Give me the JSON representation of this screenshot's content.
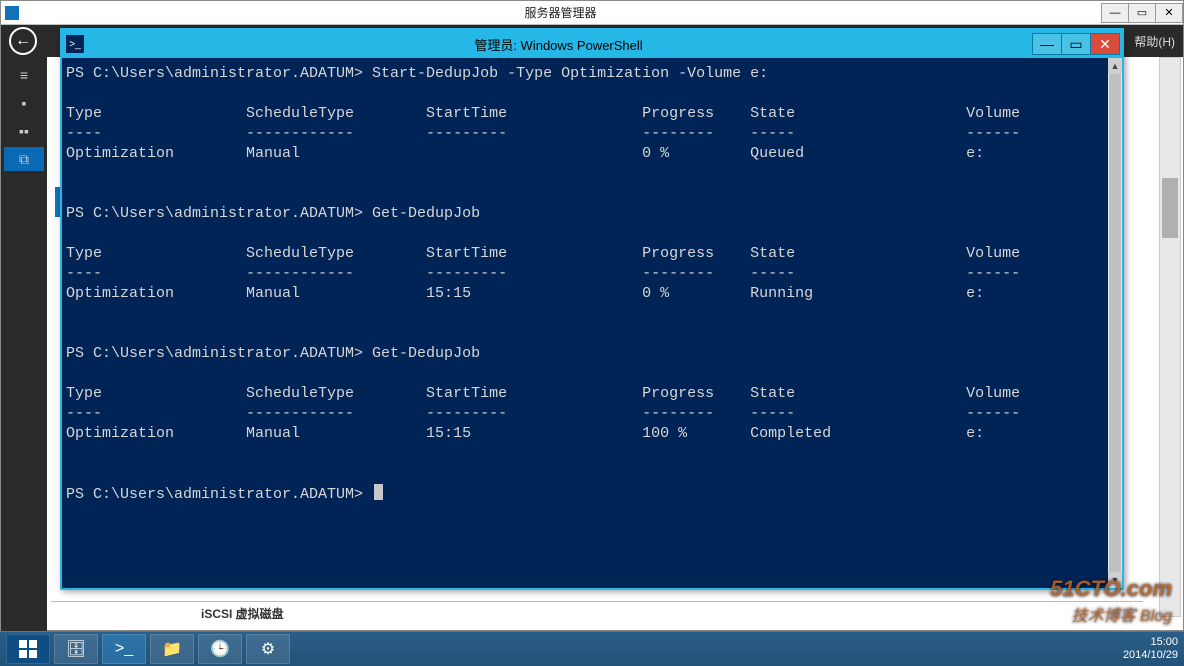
{
  "outerWindow": {
    "title": "服务器管理器",
    "helpLabel": "帮助(H)",
    "sidebar": {
      "items": [
        "≡",
        "■",
        "■",
        "⧉"
      ]
    }
  },
  "psWindow": {
    "title": "管理员: Windows PowerShell",
    "prompt": "PS C:\\Users\\administrator.ADATUM>",
    "sessions": [
      {
        "command": "Start-DedupJob -Type Optimization -Volume e:",
        "headers": [
          "Type",
          "ScheduleType",
          "StartTime",
          "Progress",
          "State",
          "Volume"
        ],
        "underlines": [
          "----",
          "------------",
          "---------",
          "--------",
          "-----",
          "------"
        ],
        "row": [
          "Optimization",
          "Manual",
          "",
          "0 %",
          "Queued",
          "e:"
        ]
      },
      {
        "command": "Get-DedupJob",
        "headers": [
          "Type",
          "ScheduleType",
          "StartTime",
          "Progress",
          "State",
          "Volume"
        ],
        "underlines": [
          "----",
          "------------",
          "---------",
          "--------",
          "-----",
          "------"
        ],
        "row": [
          "Optimization",
          "Manual",
          "15:15",
          "0 %",
          "Running",
          "e:"
        ]
      },
      {
        "command": "Get-DedupJob",
        "headers": [
          "Type",
          "ScheduleType",
          "StartTime",
          "Progress",
          "State",
          "Volume"
        ],
        "underlines": [
          "----",
          "------------",
          "---------",
          "--------",
          "-----",
          "------"
        ],
        "row": [
          "Optimization",
          "Manual",
          "15:15",
          "100 %",
          "Completed",
          "e:"
        ]
      }
    ],
    "columns": [
      0,
      20,
      40,
      64,
      76,
      100
    ]
  },
  "bottomPanel": {
    "label": "iSCSI 虚拟磁盘"
  },
  "taskbar": {
    "time": "15:00",
    "date": "2014/10/29"
  },
  "watermark": {
    "line1": "51CTO.com",
    "line2": "技术博客  Blog"
  }
}
